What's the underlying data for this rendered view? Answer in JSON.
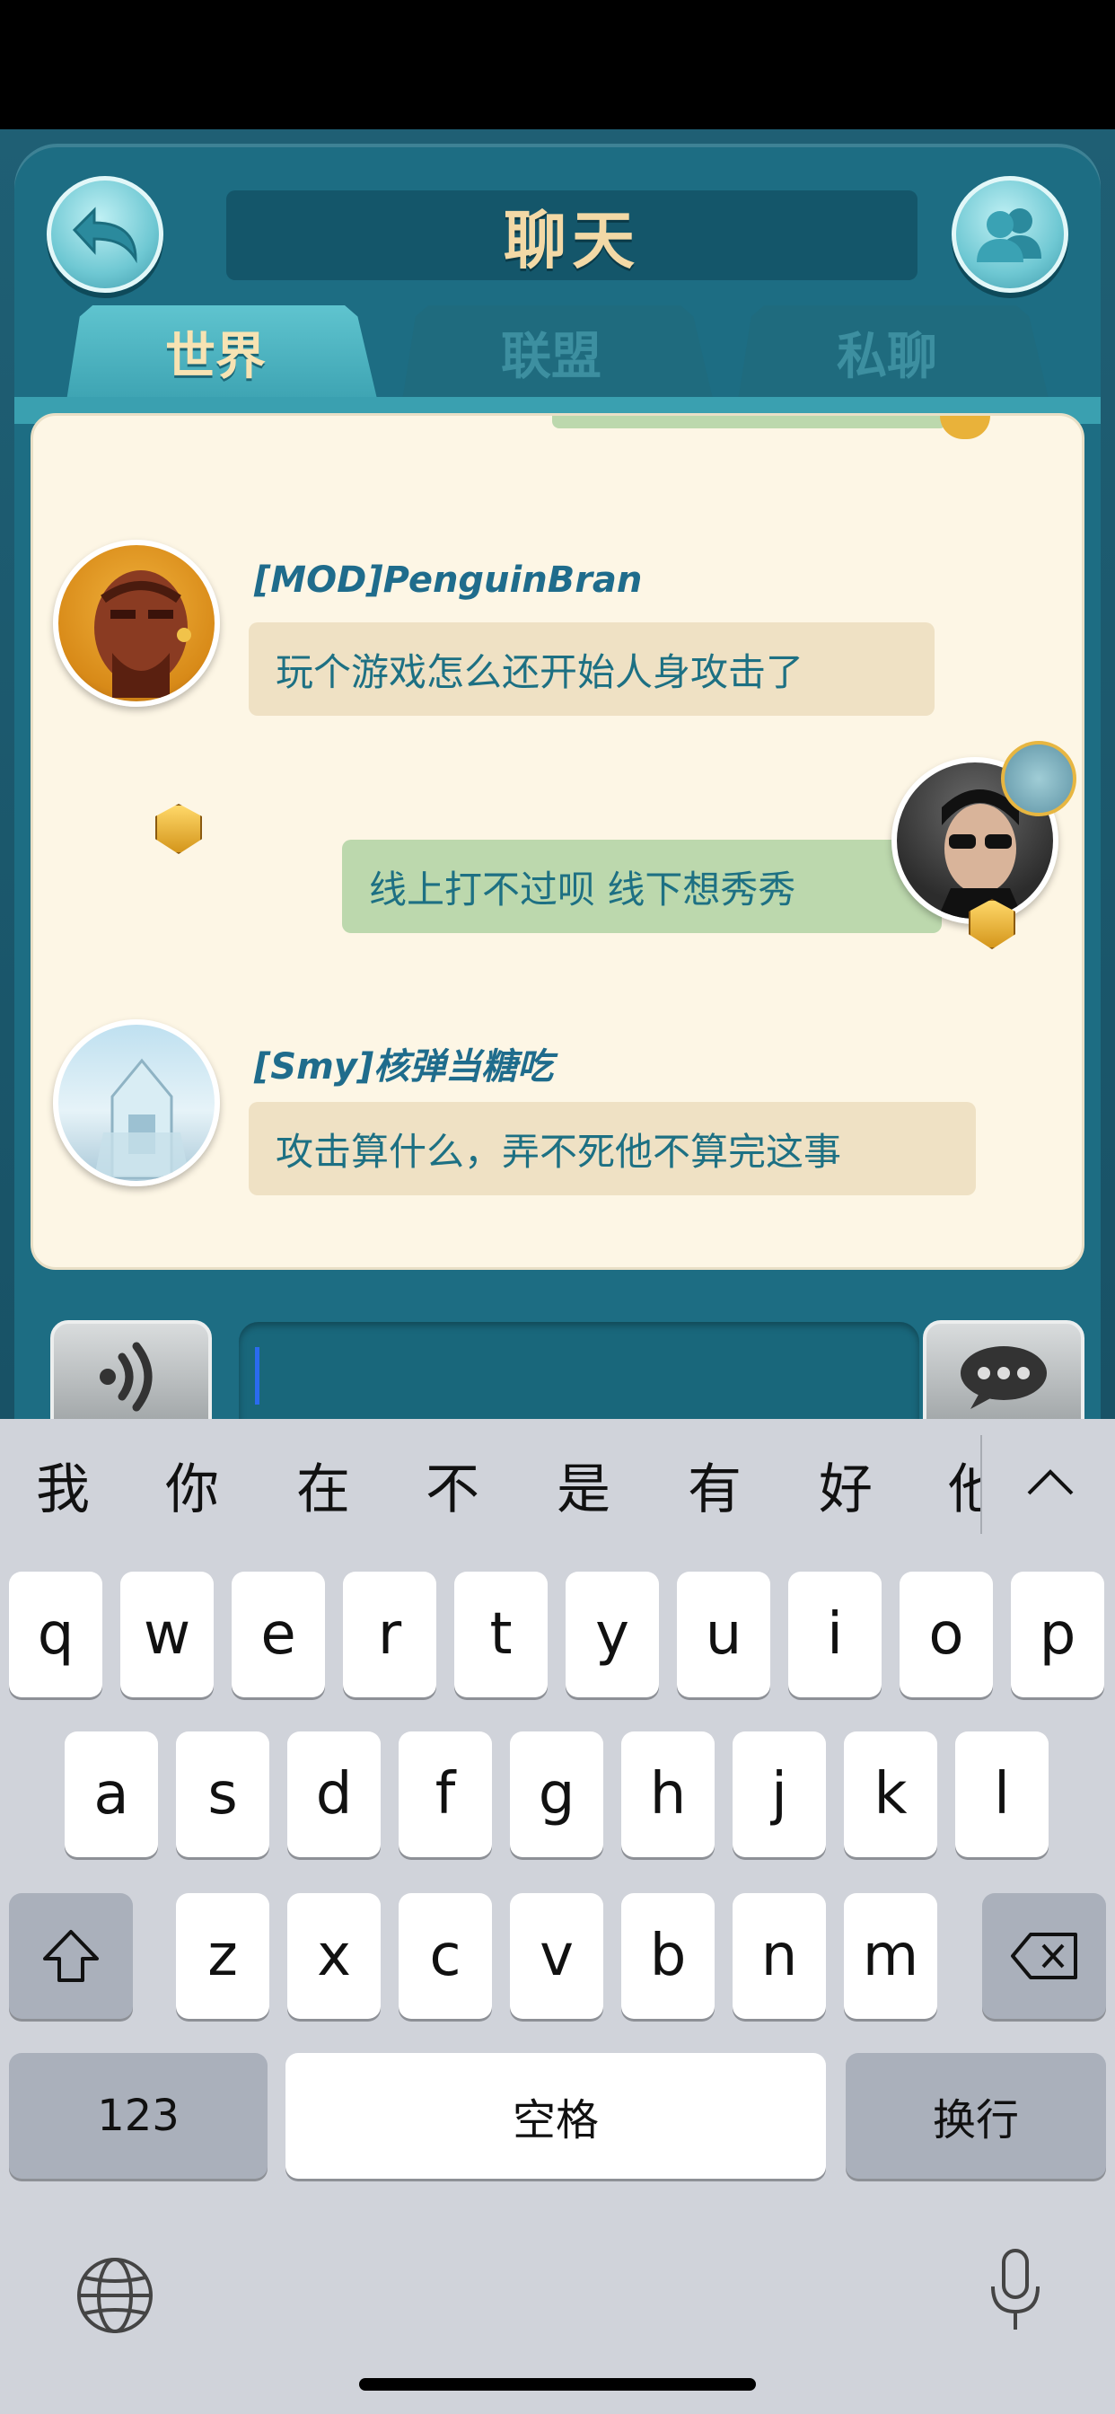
{
  "header": {
    "title": "聊天",
    "tabs": [
      {
        "label": "世界",
        "active": true
      },
      {
        "label": "联盟",
        "active": false
      },
      {
        "label": "私聊",
        "active": false
      }
    ]
  },
  "messages": [
    {
      "sender": "[MOD]PenguinBran",
      "text": "玩个游戏怎么还开始人身攻击了",
      "side": "left",
      "avatar": "bearded-man-avatar-icon",
      "badge": "gold-crest-badge-icon"
    },
    {
      "sender": "",
      "text": "线上打不过呗 线下想秀秀",
      "side": "right",
      "avatar": "man-with-sunglasses-avatar-icon",
      "badge": "gold-crest-badge-icon",
      "extra": "golden-pistol-frame-icon"
    },
    {
      "sender": "[Smy]核弹当糖吃",
      "text": "攻击算什么，弄不死他不算完这事",
      "side": "left",
      "avatar": "ice-temple-avatar-icon",
      "badge": "red-star-badge-icon"
    }
  ],
  "input": {
    "value": ""
  },
  "icons": {
    "back": "back-arrow-icon",
    "friends": "friends-icon",
    "voice": "voice-wave-icon",
    "send": "speech-bubble-icon",
    "shift": "shift-arrow-icon",
    "delete": "backspace-icon",
    "globe": "globe-icon",
    "mic": "microphone-icon",
    "expand": "chevron-up-icon"
  },
  "keyboard": {
    "candidates": [
      "我",
      "你",
      "在",
      "不",
      "是",
      "有",
      "好",
      "他"
    ],
    "row1": [
      "q",
      "w",
      "e",
      "r",
      "t",
      "y",
      "u",
      "i",
      "o",
      "p"
    ],
    "row2": [
      "a",
      "s",
      "d",
      "f",
      "g",
      "h",
      "j",
      "k",
      "l"
    ],
    "row3": [
      "z",
      "x",
      "c",
      "v",
      "b",
      "n",
      "m"
    ],
    "numbers_label": "123",
    "space_label": "空格",
    "return_label": "换行"
  },
  "colors": {
    "accent": "#3ea4b3",
    "title_text": "#f3d9a6",
    "message_text": "#1d7083",
    "name_text": "#1f6c8c",
    "bubble_left": "#efe1c4",
    "bubble_right": "#bcd8ad"
  }
}
